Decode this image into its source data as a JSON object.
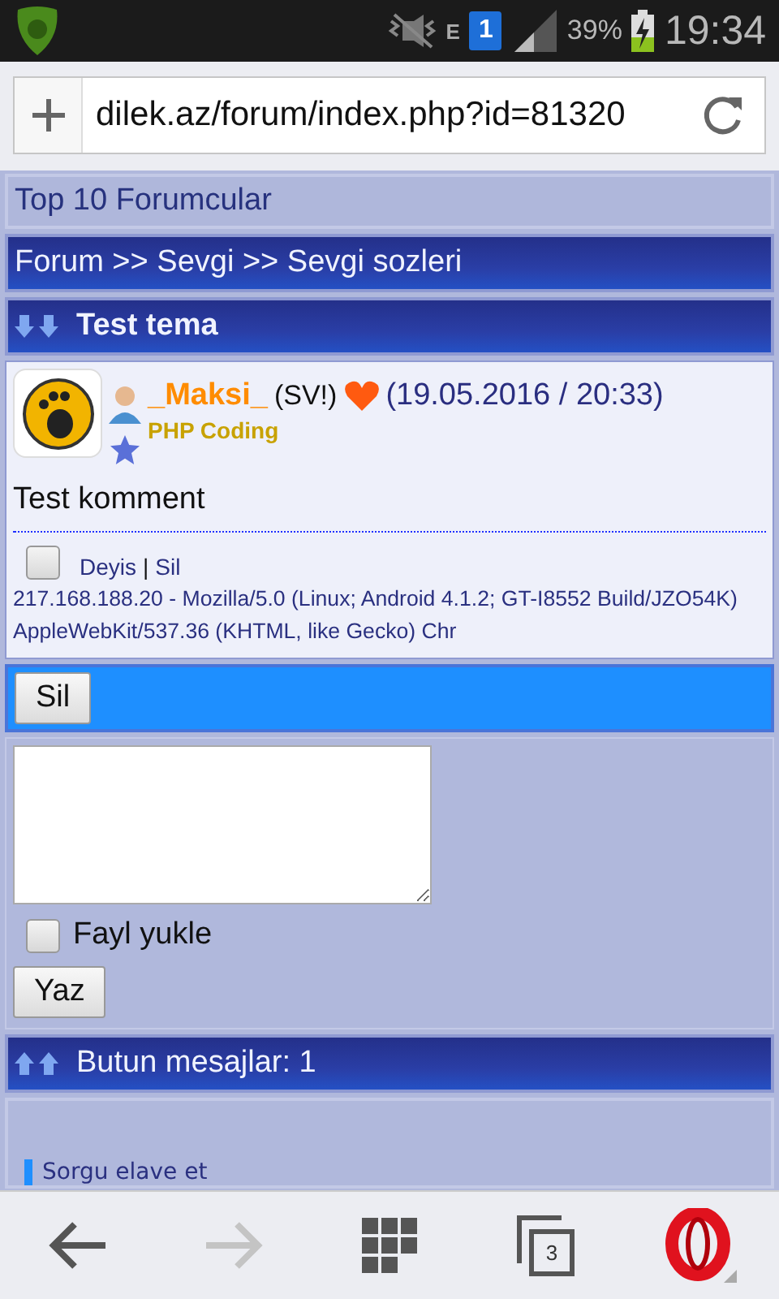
{
  "status_bar": {
    "network": "E",
    "sim": "1",
    "battery": "39%",
    "time": "19:34"
  },
  "address_bar": {
    "url": "dilek.az/forum/index.php?id=81320"
  },
  "top_link": "Top 10 Forumcular",
  "breadcrumb": "Forum >> Sevgi >> Sevgi sozleri",
  "topic": {
    "title": "Test tema"
  },
  "post": {
    "author": "_Maksi_",
    "tag": "(SV!)",
    "date": "(19.05.2016 / 20:33)",
    "rank": "PHP Coding",
    "body": "Test komment",
    "checked": false,
    "actions": [
      "Deyis",
      "Sil"
    ],
    "separator": "|",
    "info": "217.168.188.20 - Mozilla/5.0 (Linux; Android 4.1.2; GT-I8552 Build/JZO54K) AppleWebKit/537.36 (KHTML, like Gecko) Chr"
  },
  "delete_button": "Sil",
  "reply_form": {
    "attach": {
      "label": "Fayl yukle",
      "checked": false
    },
    "submit": "Yaz"
  },
  "messages_header": "Butun mesajlar: 1",
  "query_link": "Sorgu elave et",
  "bottom_nav": {
    "back_disabled": false,
    "forward_disabled": true,
    "tab_count": "3"
  }
}
